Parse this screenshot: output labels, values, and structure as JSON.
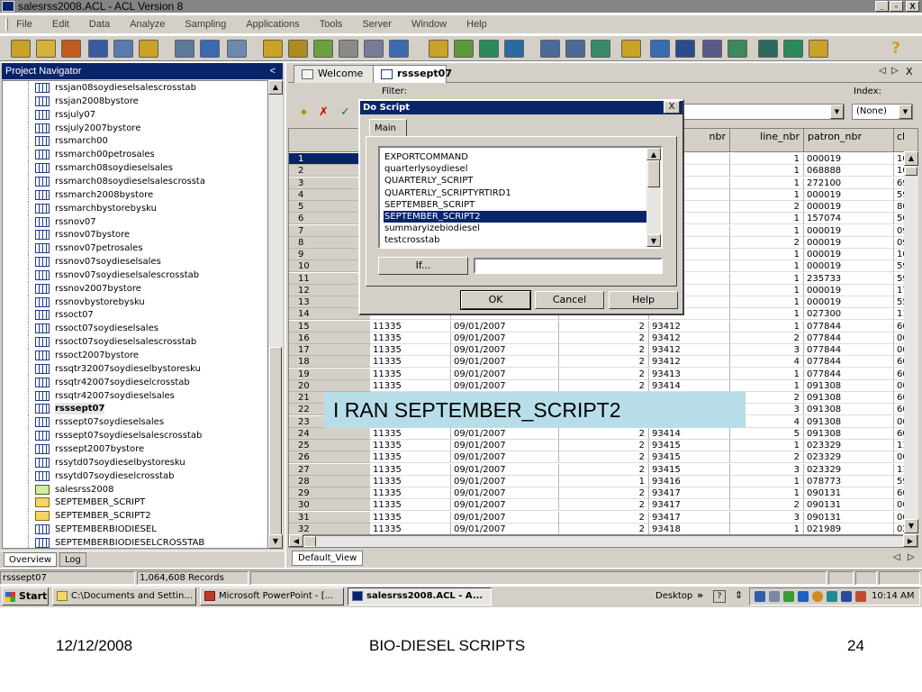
{
  "window": {
    "title": "salesrss2008.ACL - ACL Version 8",
    "buttons": [
      "_",
      "▫",
      "X"
    ]
  },
  "menu": [
    "File",
    "Edit",
    "Data",
    "Analyze",
    "Sampling",
    "Applications",
    "Tools",
    "Server",
    "Window",
    "Help"
  ],
  "toolbar_icons": [
    "open-project-icon",
    "open-table-icon",
    "new-icon",
    "save-icon",
    "print-icon",
    "search-icon",
    "refresh-icon",
    "table-layout-icon",
    "send-icon",
    "notes-icon",
    "edit-icon",
    "add-column-icon",
    "edit-view-icon",
    "graph-icon",
    "toc-icon",
    "script-icon",
    "histogram-icon",
    "recycle-icon",
    "percent-icon",
    "hierarchy-icon",
    "split-icon",
    "export-icon",
    "sort-icon",
    "text-icon",
    "number-icon",
    "stratify-icon",
    "filter-icon",
    "sum-icon",
    "clear-icon",
    "help-icon"
  ],
  "navigator": {
    "title": "Project Navigator",
    "collapse": "<",
    "items": [
      {
        "label": "rssjan08soydieselsalescrosstab",
        "type": "table"
      },
      {
        "label": "rssjan2008bystore",
        "type": "table"
      },
      {
        "label": "rssjuly07",
        "type": "table"
      },
      {
        "label": "rssjuly2007bystore",
        "type": "table"
      },
      {
        "label": "rssmarch00",
        "type": "table"
      },
      {
        "label": "rssmarch00petrosales",
        "type": "table"
      },
      {
        "label": "rssmarch08soydieselsales",
        "type": "table"
      },
      {
        "label": "rssmarch08soydieselsalescrossta",
        "type": "table"
      },
      {
        "label": "rssmarch2008bystore",
        "type": "table"
      },
      {
        "label": "rssmarchbystorebysku",
        "type": "table"
      },
      {
        "label": "rssnov07",
        "type": "table"
      },
      {
        "label": "rssnov07bystore",
        "type": "table"
      },
      {
        "label": "rssnov07petrosales",
        "type": "table"
      },
      {
        "label": "rssnov07soydieselsales",
        "type": "table"
      },
      {
        "label": "rssnov07soydieselsalescrosstab",
        "type": "table"
      },
      {
        "label": "rssnov2007bystore",
        "type": "table"
      },
      {
        "label": "rssnovbystorebysku",
        "type": "table"
      },
      {
        "label": "rssoct07",
        "type": "table"
      },
      {
        "label": "rssoct07soydieselsales",
        "type": "table"
      },
      {
        "label": "rssoct07soydieselsalescrosstab",
        "type": "table"
      },
      {
        "label": "rssoct2007bystore",
        "type": "table"
      },
      {
        "label": "rssqtr32007soydieselbystoresku",
        "type": "table"
      },
      {
        "label": "rssqtr42007soydieselcrosstab",
        "type": "table"
      },
      {
        "label": "rssqtr42007soydieselsales",
        "type": "table"
      },
      {
        "label": "rsssept07",
        "type": "table",
        "selected": true
      },
      {
        "label": "rsssept07soydieselsales",
        "type": "table"
      },
      {
        "label": "rsssept07soydieselsalescrosstab",
        "type": "table"
      },
      {
        "label": "rsssept2007bystore",
        "type": "table"
      },
      {
        "label": "rssytd07soydieselbystoresku",
        "type": "table"
      },
      {
        "label": "rssytd07soydieselcrosstab",
        "type": "table"
      },
      {
        "label": "salesrss2008",
        "type": "project"
      },
      {
        "label": "SEPTEMBER_SCRIPT",
        "type": "script"
      },
      {
        "label": "SEPTEMBER_SCRIPT2",
        "type": "script"
      },
      {
        "label": "SEPTEMBERBIODIESEL",
        "type": "table"
      },
      {
        "label": "SEPTEMBERBIODIESELCROSSTAB",
        "type": "table"
      }
    ],
    "bottom_tabs": [
      "Overview",
      "Log"
    ]
  },
  "view_tabs": [
    {
      "label": "Welcome",
      "active": false
    },
    {
      "label": "rsssept07",
      "active": true
    }
  ],
  "view_nav": [
    "◁",
    "▷",
    "X"
  ],
  "filter": {
    "label": "Filter:",
    "value": ""
  },
  "index": {
    "label": "Index:",
    "value": "(None)"
  },
  "grid": {
    "columns": [
      "",
      "",
      "",
      "nbr",
      "line_nbr",
      "patron_nbr",
      "cl"
    ],
    "row_numbers": [
      "1",
      "2",
      "3",
      "4",
      "5",
      "6",
      "7",
      "8",
      "9",
      "10",
      "11",
      "12",
      "13",
      "14",
      "15",
      "16",
      "17",
      "18",
      "19",
      "20",
      "21",
      "22",
      "23",
      "24",
      "25",
      "26",
      "27",
      "28",
      "29",
      "30",
      "31",
      "32"
    ],
    "rows": [
      [
        "",
        "",
        "",
        "",
        "1",
        "000019",
        "10"
      ],
      [
        "",
        "",
        "",
        "",
        "1",
        "068888",
        "10"
      ],
      [
        "",
        "",
        "",
        "",
        "1",
        "272100",
        "69"
      ],
      [
        "",
        "",
        "",
        "",
        "1",
        "000019",
        "59"
      ],
      [
        "",
        "",
        "",
        "",
        "2",
        "000019",
        "80"
      ],
      [
        "",
        "",
        "",
        "",
        "1",
        "157074",
        "50"
      ],
      [
        "",
        "",
        "",
        "",
        "1",
        "000019",
        "09"
      ],
      [
        "",
        "",
        "",
        "",
        "2",
        "000019",
        "09"
      ],
      [
        "",
        "",
        "",
        "",
        "1",
        "000019",
        "10"
      ],
      [
        "",
        "",
        "",
        "",
        "1",
        "000019",
        "59"
      ],
      [
        "",
        "",
        "",
        "",
        "1",
        "235733",
        "59"
      ],
      [
        "",
        "",
        "",
        "",
        "1",
        "000019",
        "17"
      ],
      [
        "",
        "",
        "",
        "",
        "1",
        "000019",
        "55"
      ],
      [
        "",
        "",
        "",
        "",
        "1",
        "027300",
        "11"
      ],
      [
        "11335",
        "09/01/2007",
        "2",
        "93412",
        "1",
        "077844",
        "60"
      ],
      [
        "11335",
        "09/01/2007",
        "2",
        "93412",
        "2",
        "077844",
        "00"
      ],
      [
        "11335",
        "09/01/2007",
        "2",
        "93412",
        "3",
        "077844",
        "00"
      ],
      [
        "11335",
        "09/01/2007",
        "2",
        "93412",
        "4",
        "077844",
        "60"
      ],
      [
        "11335",
        "09/01/2007",
        "2",
        "93413",
        "1",
        "077844",
        "60"
      ],
      [
        "11335",
        "09/01/2007",
        "2",
        "93414",
        "1",
        "091308",
        "00"
      ],
      [
        "",
        "",
        "",
        "",
        "2",
        "091308",
        "60"
      ],
      [
        "",
        "",
        "",
        "",
        "3",
        "091308",
        "60"
      ],
      [
        "",
        "",
        "",
        "",
        "4",
        "091308",
        "00"
      ],
      [
        "11335",
        "09/01/2007",
        "2",
        "93414",
        "5",
        "091308",
        "60"
      ],
      [
        "11335",
        "09/01/2007",
        "2",
        "93415",
        "1",
        "023329",
        "11"
      ],
      [
        "11335",
        "09/01/2007",
        "2",
        "93415",
        "2",
        "023329",
        "00"
      ],
      [
        "11335",
        "09/01/2007",
        "2",
        "93415",
        "3",
        "023329",
        "11"
      ],
      [
        "11335",
        "09/01/2007",
        "1",
        "93416",
        "1",
        "078773",
        "59"
      ],
      [
        "11335",
        "09/01/2007",
        "2",
        "93417",
        "1",
        "090131",
        "60"
      ],
      [
        "11335",
        "09/01/2007",
        "2",
        "93417",
        "2",
        "090131",
        "00"
      ],
      [
        "11335",
        "09/01/2007",
        "2",
        "93417",
        "3",
        "090131",
        "00"
      ],
      [
        "11335",
        "09/01/2007",
        "2",
        "93418",
        "1",
        "021989",
        "02"
      ]
    ]
  },
  "default_view_tab": "Default_View",
  "dialog": {
    "title": "Do Script",
    "close": "X",
    "tab": "Main",
    "scripts": [
      "EXPORTCOMMAND",
      "quarterlysoydiesel",
      "QUARTERLY_SCRIPT",
      "QUARTERLY_SCRIPTYRTIRD1",
      "SEPTEMBER_SCRIPT",
      "SEPTEMBER_SCRIPT2",
      "summaryizebiodiesel",
      "testcrosstab"
    ],
    "selected_script": "SEPTEMBER_SCRIPT2",
    "if_label": "If...",
    "if_value": "",
    "ok": "OK",
    "cancel": "Cancel",
    "help": "Help"
  },
  "annotation": "I RAN SEPTEMBER_SCRIPT2",
  "status": {
    "table": "rsssept07",
    "records": "1,064,608 Records"
  },
  "taskbar": {
    "start": "Start",
    "tasks": [
      {
        "label": "C:\\Documents and Settin...",
        "active": false
      },
      {
        "label": "Microsoft PowerPoint - [...",
        "active": false
      },
      {
        "label": "salesrss2008.ACL - A...",
        "active": true
      }
    ],
    "desktop": "Desktop",
    "chevron": "»",
    "clock": "10:14 AM"
  },
  "footer": {
    "date": "12/12/2008",
    "title": "BIO-DIESEL SCRIPTS",
    "page": "24"
  },
  "colors": {
    "titlebar": "#848484",
    "selection": "#0a246a",
    "annotation_bg": "#b7dde8",
    "window_face": "#d4d0c8"
  }
}
